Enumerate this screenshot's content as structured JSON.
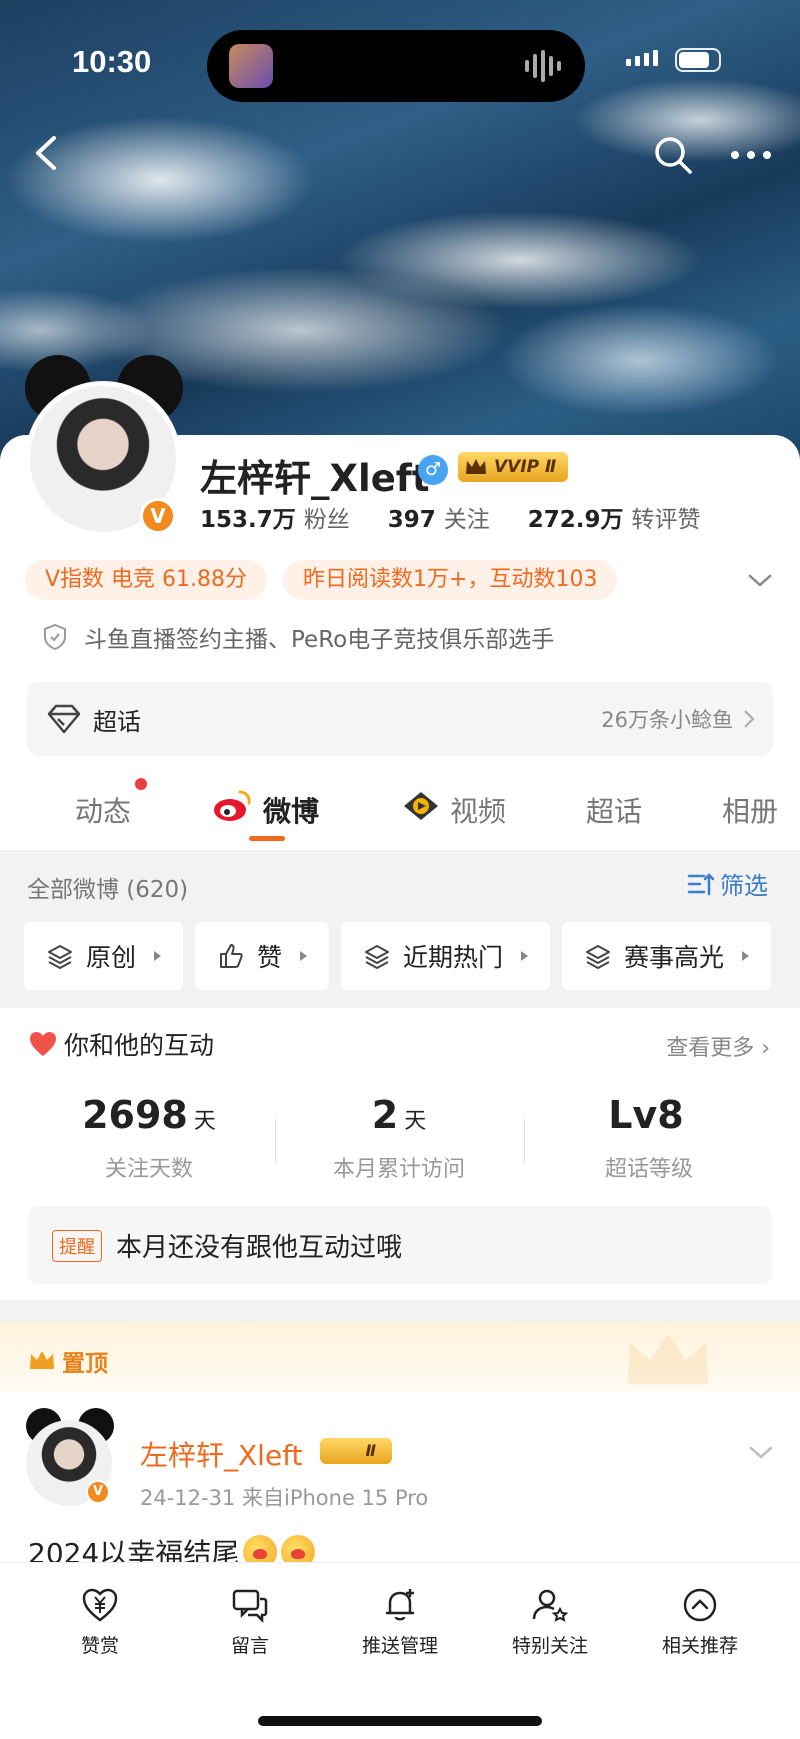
{
  "status_bar": {
    "time": "10:30"
  },
  "profile": {
    "name": "左梓轩_Xleft",
    "vip_label": "VVIP Ⅱ",
    "verified_mark": "V",
    "stats": [
      {
        "value": "153.7万",
        "label": "粉丝"
      },
      {
        "value": "397",
        "label": "关注"
      },
      {
        "value": "272.9万",
        "label": "转评赞"
      }
    ],
    "chips": [
      "V指数 电竞 61.88分",
      "昨日阅读数1万+，互动数103"
    ],
    "description": "斗鱼直播签约主播、PeRo电子竞技俱乐部选手",
    "supertopic": {
      "label": "超话",
      "count": "26万条小鲶鱼"
    }
  },
  "tabs": [
    {
      "label": "动态"
    },
    {
      "label": "微博"
    },
    {
      "label": "视频"
    },
    {
      "label": "超话"
    },
    {
      "label": "相册"
    }
  ],
  "filter": {
    "all_label": "全部微博 (620)",
    "screen_label": "筛选",
    "pills": [
      "原创",
      "赞",
      "近期热门",
      "赛事高光"
    ]
  },
  "interaction": {
    "title": "你和他的互动",
    "more": "查看更多",
    "metrics": [
      {
        "num": "2698",
        "unit": "天",
        "label": "关注天数"
      },
      {
        "num": "2",
        "unit": "天",
        "label": "本月累计访问"
      },
      {
        "num": "Lv8",
        "unit": "",
        "label": "超话等级"
      }
    ],
    "remind_tag": "提醒",
    "remind_text": "本月还没有跟他互动过哦"
  },
  "post": {
    "pin_label": "置顶",
    "author": "左梓轩_Xleft",
    "badge": "Ⅱ",
    "meta": "24-12-31  来自iPhone 15 Pro",
    "text": "2024以幸福结尾"
  },
  "bottom_bar": [
    "赞赏",
    "留言",
    "推送管理",
    "特别关注",
    "相关推荐"
  ],
  "colors": {
    "accent": "#f06a1e",
    "link": "#3b7dc8",
    "vip_gold": "#e8a620"
  }
}
